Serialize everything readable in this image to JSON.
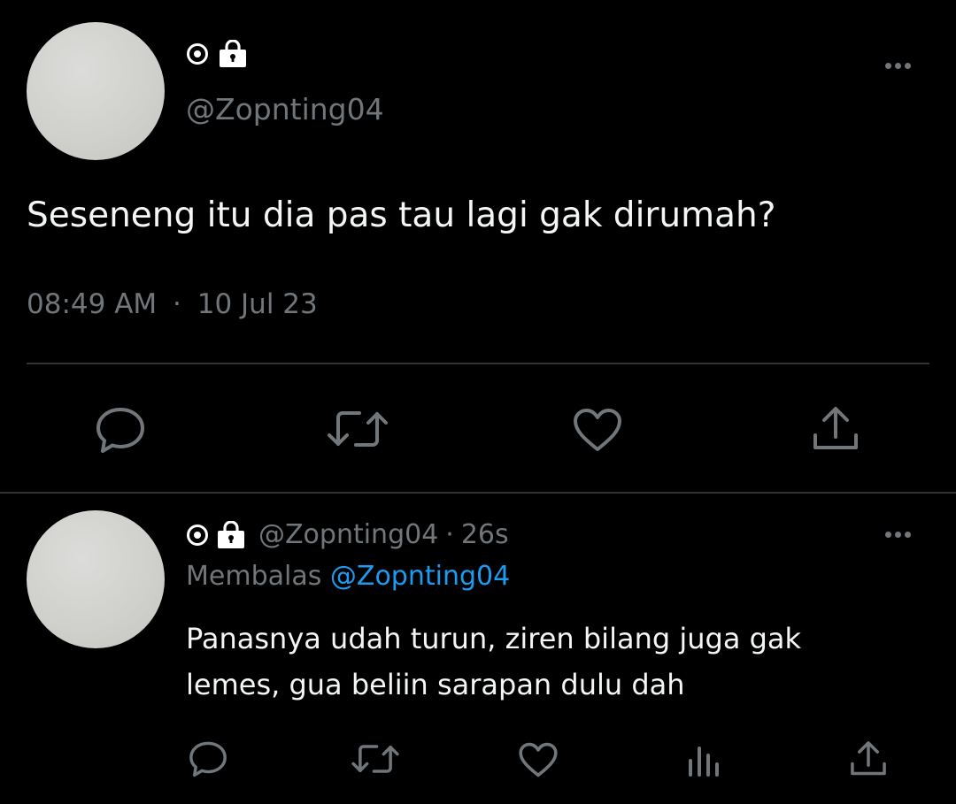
{
  "main_tweet": {
    "handle": "@Zopnting04",
    "text": "Seseneng itu dia pas tau lagi gak dirumah?",
    "time": "08:49 AM",
    "separator": "·",
    "date": "10 Jul 23"
  },
  "reply_tweet": {
    "handle": "@Zopnting04",
    "separator": "·",
    "age": "26s",
    "replying_prefix": "Membalas",
    "replying_to": "@Zopnting04",
    "text_line1": "Panasnya udah turun, ziren bilang juga gak",
    "text_line2": "lemes, gua beliin sarapan dulu dah"
  },
  "icons": {
    "name_icons": [
      "target-icon",
      "lock-bag-icon"
    ],
    "main_actions": [
      "reply-icon",
      "retweet-icon",
      "like-icon",
      "share-icon"
    ],
    "reply_actions": [
      "reply-icon",
      "retweet-icon",
      "like-icon",
      "views-icon",
      "share-icon"
    ]
  },
  "colors": {
    "background": "#000000",
    "text": "#e7e9ea",
    "muted": "#71767b",
    "link": "#1d9bf0",
    "divider": "#2f3336"
  }
}
